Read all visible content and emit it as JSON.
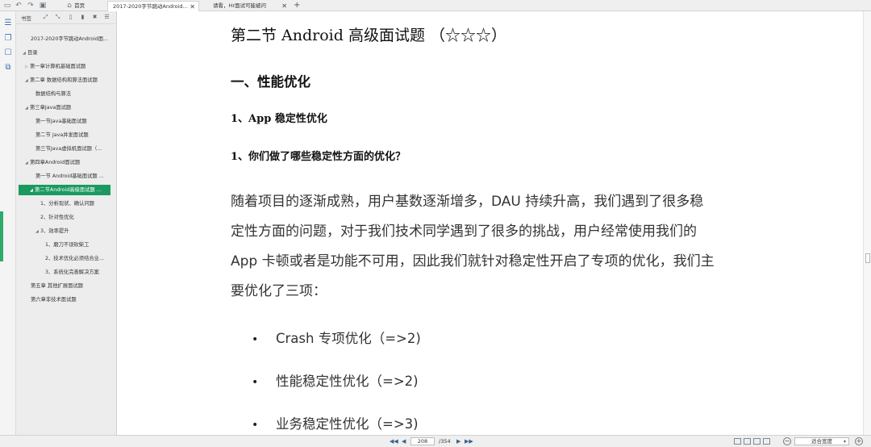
{
  "tabs": [
    {
      "label": "首页"
    },
    {
      "label": "2017-2020字节跳动Android..."
    },
    {
      "label": "请看，Hr面试可能被问"
    }
  ],
  "tab_close": "✕",
  "tab_add": "+",
  "panel": {
    "title": "书签",
    "items": [
      {
        "label": "2017-2020字节跳动Android面...",
        "arrow": ""
      },
      {
        "label": "目录",
        "arrow": "◢"
      },
      {
        "label": "第一章计算机基础面试题",
        "arrow": "▷"
      },
      {
        "label": "第二章 数据结构和算法面试题",
        "arrow": "◢"
      },
      {
        "label": "数据结构与算法",
        "arrow": ""
      },
      {
        "label": "第三章Java面试题",
        "arrow": "◢"
      },
      {
        "label": "第一节Java基础面试题",
        "arrow": ""
      },
      {
        "label": "第二节 Java并发面试题",
        "arrow": ""
      },
      {
        "label": "第三节Java虚拟机面试题（...",
        "arrow": ""
      },
      {
        "label": "第四章Android面试题",
        "arrow": "◢"
      },
      {
        "label": "第一节 Android基础面试题 ...",
        "arrow": ""
      },
      {
        "label": "第二节Android高级面试题 ...",
        "arrow": "◢"
      },
      {
        "label": "1、分析现状、确认问题",
        "arrow": ""
      },
      {
        "label": "2、针对性优化",
        "arrow": ""
      },
      {
        "label": "3、效率提升",
        "arrow": "◢"
      },
      {
        "label": "1、磨刀不误砍柴工",
        "arrow": ""
      },
      {
        "label": "2、技术优化必须结合业...",
        "arrow": ""
      },
      {
        "label": "3、系统化完善解决方案",
        "arrow": ""
      },
      {
        "label": "第五章 其他扩展面试题",
        "arrow": ""
      },
      {
        "label": "第六章非技术面试题",
        "arrow": ""
      }
    ]
  },
  "document": {
    "title": "第二节 Android 高级面试题 （☆☆☆）",
    "section": "一、性能优化",
    "subsection": "1、App 稳定性优化",
    "question": "1、你们做了哪些稳定性方面的优化？",
    "paragraph_lines": [
      "随着项目的逐渐成熟，用户基数逐渐增多，DAU 持续升高，我们遇到了很多稳",
      "定性方面的问题，对于我们技术同学遇到了很多的挑战，用户经常使用我们的",
      "App 卡顿或者是功能不可用，因此我们就针对稳定性开启了专项的优化，我们主",
      "要优化了三项："
    ],
    "bullet_symbol": "•",
    "bullets": [
      "Crash 专项优化（=>2)",
      "性能稳定性优化（=>2)",
      "业务稳定性优化（=>3)"
    ]
  },
  "status": {
    "page_current": "208",
    "page_total": "/354",
    "zoom_label": "适合宽度",
    "zoom_out": "−",
    "zoom_in": "+",
    "caret": "▾"
  },
  "icons": {
    "first_page": "◀◀",
    "prev_page": "◀",
    "next_page": "▶",
    "last_page": "▶▶",
    "menu": "☰",
    "copy": "❐",
    "comment": "☐",
    "attach": "⧉"
  },
  "colors": {
    "accent_green": "#1a9a60",
    "rail_handle": "#2faa6b",
    "text_primary": "#111111"
  }
}
